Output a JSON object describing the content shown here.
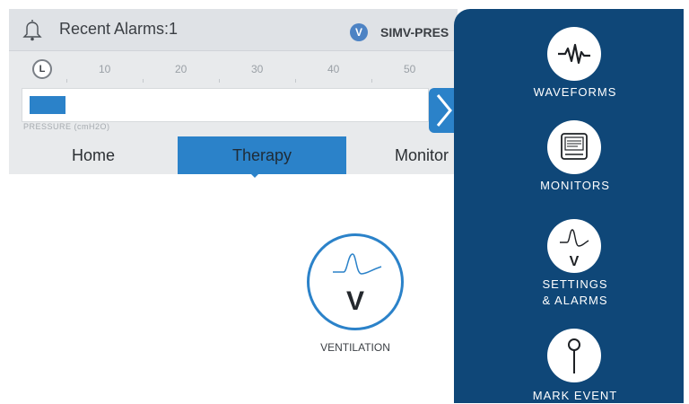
{
  "header": {
    "alarms_text": "Recent Alarms:1",
    "mode_badge": "V",
    "mode_text": "SIMV-PRES"
  },
  "scale": {
    "start_marker": "L",
    "ticks": [
      "10",
      "20",
      "30",
      "40",
      "50"
    ]
  },
  "pressure": {
    "label": "PRESSURE (cmH2O)",
    "fill_fraction": 0.09
  },
  "tabs": [
    "Home",
    "Therapy",
    "Monitor"
  ],
  "active_tab": "Therapy",
  "ventilation": {
    "letter": "V",
    "label": "VENTILATION"
  },
  "side_menu": {
    "items": [
      {
        "label_line1": "WAVEFORMS",
        "label_line2": "",
        "icon": "waveform-icon"
      },
      {
        "label_line1": "MONITORS",
        "label_line2": "",
        "icon": "monitor-icon"
      },
      {
        "label_line1": "SETTINGS",
        "label_line2": "& ALARMS",
        "icon": "settings-alarms-icon"
      },
      {
        "label_line1": "MARK EVENT",
        "label_line2": "",
        "icon": "pin-icon"
      }
    ]
  },
  "colors": {
    "accent": "#2b82c9",
    "menu_bg": "#0f4778",
    "panel_bg": "#e8eaec"
  }
}
